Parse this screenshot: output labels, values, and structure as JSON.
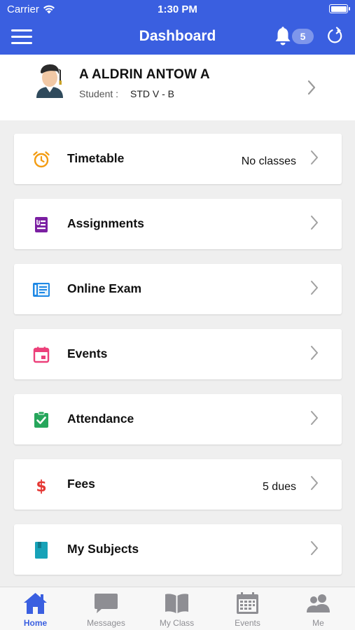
{
  "status_bar": {
    "carrier": "Carrier",
    "time": "1:30 PM"
  },
  "nav": {
    "title": "Dashboard",
    "notification_count": "5"
  },
  "profile": {
    "name": "A ALDRIN ANTOW A",
    "role_label": "Student :",
    "class_value": "STD V - B"
  },
  "menu": [
    {
      "label": "Timetable",
      "value": "No classes",
      "icon": "alarm-clock-icon",
      "color": "#f39c12"
    },
    {
      "label": "Assignments",
      "value": "",
      "icon": "assignment-icon",
      "color": "#7b1fa2"
    },
    {
      "label": "Online Exam",
      "value": "",
      "icon": "online-exam-icon",
      "color": "#1e88e5"
    },
    {
      "label": "Events",
      "value": "",
      "icon": "calendar-icon",
      "color": "#ec407a"
    },
    {
      "label": "Attendance",
      "value": "",
      "icon": "clipboard-check-icon",
      "color": "#26a65b"
    },
    {
      "label": "Fees",
      "value": "5 dues",
      "icon": "dollar-icon",
      "color": "#e53935"
    },
    {
      "label": "My Subjects",
      "value": "",
      "icon": "book-icon",
      "color": "#17a2b8"
    }
  ],
  "tabs": [
    {
      "label": "Home",
      "icon": "home-icon",
      "active": true
    },
    {
      "label": "Messages",
      "icon": "chat-icon",
      "active": false
    },
    {
      "label": "My Class",
      "icon": "open-book-icon",
      "active": false
    },
    {
      "label": "Events",
      "icon": "calendar-grid-icon",
      "active": false
    },
    {
      "label": "Me",
      "icon": "people-icon",
      "active": false
    }
  ],
  "colors": {
    "primary": "#3a5fe0",
    "background": "#efefef",
    "tab_inactive": "#8e8e93"
  }
}
